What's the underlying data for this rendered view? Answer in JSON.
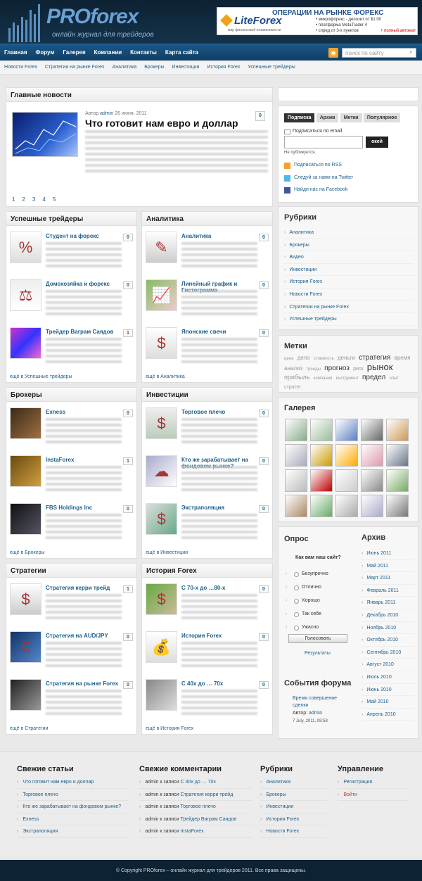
{
  "header": {
    "logo_title": "PROforex",
    "logo_sub": "онлайн журнал для трейдеров",
    "banner": {
      "title": "ОПЕРАЦИИ НА РЫНКЕ ФОРЕКС",
      "brand": "LiteForex",
      "slogan": "мир финансовой независимости",
      "lines": [
        "• микрофорекс - депозит от $1.00",
        "• платформа MetaTrader 4",
        "• спред от 3-х пунктов"
      ],
      "offer": "+ полный автомат"
    }
  },
  "nav": {
    "items": [
      "Главная",
      "Форум",
      "Галерея",
      "Компании",
      "Контакты",
      "Карта сайта"
    ],
    "search_placeholder": "поиск по сайту"
  },
  "subnav": [
    "Новости Forex",
    "Стратегии на рынке Forex",
    "Аналитика",
    "Брокеры",
    "Инвестиции",
    "История Forex",
    "Успешные трейдеры"
  ],
  "main_news": {
    "heading": "Главные новости",
    "meta_prefix": "Автор",
    "author": "admin",
    "date": "26 июня, 2011",
    "title": "Что готовит нам евро и доллар",
    "count": "0",
    "pages": [
      "1",
      "2",
      "3",
      "4",
      "5"
    ]
  },
  "sections": [
    {
      "heading": "Успешные трейдеры",
      "items": [
        {
          "title": "Студент на форекс",
          "count": "0"
        },
        {
          "title": "Домохозяйка и форекс",
          "count": "0"
        },
        {
          "title": "Трейдер Ваграм Саядов",
          "count": "1"
        }
      ],
      "more": "ещё в Успешные трейдеры"
    },
    {
      "heading": "Аналитика",
      "items": [
        {
          "title": "Аналитика",
          "count": "0"
        },
        {
          "title": "Линейный график и Гистограмма",
          "count": "0"
        },
        {
          "title": "Японские свечи",
          "count": "0"
        }
      ],
      "more": "ещё в Аналитика"
    },
    {
      "heading": "Брокеры",
      "items": [
        {
          "title": "Exness",
          "count": "0"
        },
        {
          "title": "InstaForex",
          "count": "1"
        },
        {
          "title": "FBS Holdings Inc",
          "count": "0"
        }
      ],
      "more": "ещё в Брокеры"
    },
    {
      "heading": "Инвестиции",
      "items": [
        {
          "title": "Торговое плечо",
          "count": "0"
        },
        {
          "title": "Кто же зарабатывает на фондовом рынке?",
          "count": "0"
        },
        {
          "title": "Экстраполяция",
          "count": "0"
        }
      ],
      "more": "ещё в Инвестиции"
    },
    {
      "heading": "Стратегии",
      "items": [
        {
          "title": "Стратегия керри трейд",
          "count": "1"
        },
        {
          "title": "Стратегия на AUD/JPY",
          "count": "0"
        },
        {
          "title": "Стратегия на рынке Forex",
          "count": "0"
        }
      ],
      "more": "ещё в Стратегии"
    },
    {
      "heading": "История Forex",
      "items": [
        {
          "title": "С 70-х до …80-х",
          "count": "0"
        },
        {
          "title": "История Forex",
          "count": "0"
        },
        {
          "title": "С 40х до … 70х",
          "count": "0"
        }
      ],
      "more": "ещё в История Forex"
    }
  ],
  "sidebar": {
    "tabs": [
      "Подписка",
      "Архив",
      "Метки",
      "Популярное"
    ],
    "subscribe_label": "Подписаться по email",
    "subscribe_btn": "окей",
    "no_publish": "Не публикуется.",
    "links": [
      "Подписаться по RSS",
      "Следуй за нами на Twitter",
      "Найди нас на Facebook"
    ],
    "rubrics_heading": "Рубрики",
    "rubrics": [
      "Аналитика",
      "Брокеры",
      "Видео",
      "Инвестиции",
      "История Forex",
      "Новости Forex",
      "Стратегии на рынке Forex",
      "Успешные трейдеры"
    ],
    "tags_heading": "Метки",
    "tags": [
      "цена",
      "дело",
      "стоимость",
      "деньги",
      "стратегия",
      "время",
      "анализ",
      "тренды",
      "прогноз",
      "риск",
      "рынок",
      "прибыль",
      "компания",
      "инструмент",
      "предел",
      "опыт",
      "стратег"
    ],
    "gallery_heading": "Галерея",
    "poll_heading": "Опрос",
    "poll_question": "Как вам наш сайт?",
    "poll_options": [
      "Безупречно",
      "Отлично",
      "Хорошо",
      "Так себе",
      "Ужасно"
    ],
    "poll_vote": "Голосовать",
    "poll_results": "Результаты",
    "archive_heading": "Архив",
    "archive": [
      "Июнь 2011",
      "Май 2011",
      "Март 2011",
      "Февраль 2011",
      "Январь 2011",
      "Декабрь 2010",
      "Ноябрь 2010",
      "Октябрь 2010",
      "Сентябрь 2010",
      "Август 2010",
      "Июль 2010",
      "Июнь 2010",
      "Май 2010",
      "Апрель 2010"
    ],
    "forum_heading": "События форума",
    "forum_item": "Время совершение сделки",
    "forum_author_label": "Автор:",
    "forum_author": "admin",
    "forum_date": "7 July, 2011, 08:58"
  },
  "footer": {
    "cols": [
      {
        "heading": "Свежие статьи",
        "items": [
          "Что готовит нам евро и доллар",
          "Торговое плечо",
          "Кто же зарабатывает на фондовом рынке?",
          "Exness",
          "Экстраполяция"
        ]
      },
      {
        "heading": "Свежие комментарии",
        "items": [
          [
            "admin к записи ",
            "С 40х до … 70х"
          ],
          [
            "admin к записи ",
            "Стратегия керри трейд"
          ],
          [
            "admin к записи ",
            "Торговое плечо"
          ],
          [
            "admin к записи ",
            "Трейдер Ваграм Саядов"
          ],
          [
            "admin к записи ",
            "InstaForex"
          ]
        ]
      },
      {
        "heading": "Рубрики",
        "items": [
          "Аналитика",
          "Брокеры",
          "Инвестиции",
          "История Forex",
          "Новости Forex"
        ]
      },
      {
        "heading": "Управление",
        "items": [
          "Регистрация",
          "Войти"
        ]
      }
    ],
    "copyright": "© Copyright PROforex – онлайн журнал для трейдеров 2011. Все права защищены."
  },
  "colors": {
    "brand": "#1d5f8a",
    "header": "#0d2233",
    "nav": "#1a5789",
    "logout": "#c0392b"
  }
}
